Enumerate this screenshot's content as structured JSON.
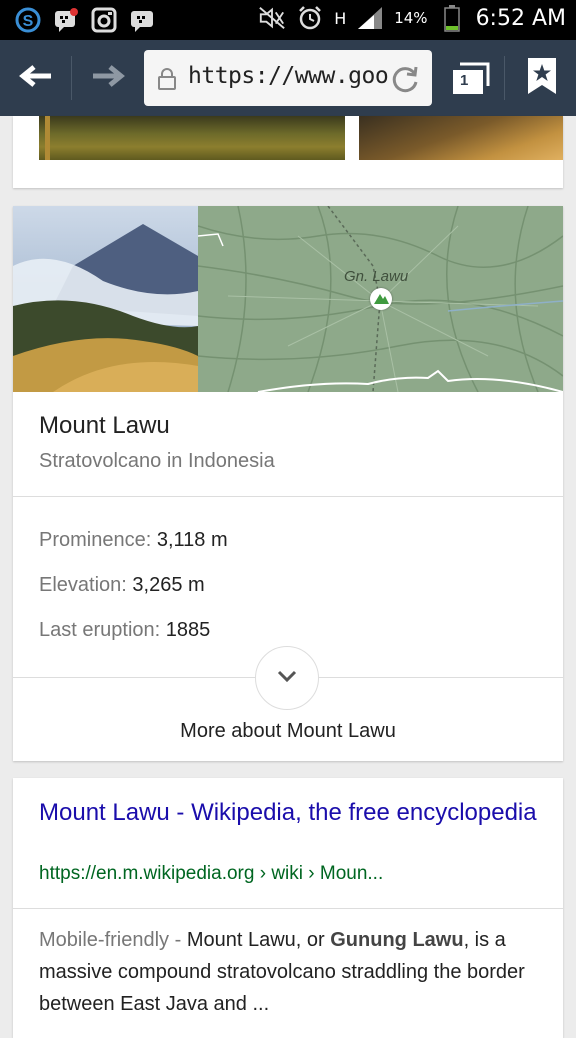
{
  "status_bar": {
    "battery_percent": "14%",
    "time": "6:52 AM",
    "network_type": "H",
    "icons": [
      "skype-icon",
      "bbm-icon",
      "instagram-icon",
      "bbm-icon",
      "mute-icon",
      "alarm-icon",
      "data-arrows-icon",
      "signal-icon",
      "battery-icon"
    ]
  },
  "toolbar": {
    "url": "https://www.goo",
    "tab_count": "1",
    "icons": [
      "back-arrow-icon",
      "forward-arrow-icon",
      "lock-icon",
      "reload-icon",
      "tabs-icon",
      "bookmark-star-icon"
    ]
  },
  "knowledge_panel": {
    "map_label": "Gn. Lawu",
    "title": "Mount Lawu",
    "subtitle": "Stratovolcano in Indonesia",
    "facts": [
      {
        "label": "Prominence:",
        "value": "3,118 m"
      },
      {
        "label": "Elevation:",
        "value": "3,265 m"
      },
      {
        "label": "Last eruption:",
        "value": "1885"
      }
    ],
    "more_label": "More about Mount Lawu"
  },
  "result": {
    "title": "Mount Lawu - Wikipedia, the free encyclopedia",
    "url": "https://en.m.wikipedia.org › wiki › Moun...",
    "mobile_friendly": "Mobile-friendly - ",
    "snippet_part1": "Mount Lawu, or ",
    "snippet_bold": "Gunung Lawu",
    "snippet_part2": ", is a massive compound stratovolcano straddling the border between East Java and ..."
  },
  "colors": {
    "toolbar_bg": "#2f3d4e",
    "link_blue": "#1a0dab",
    "url_green": "#006621",
    "map_green": "#8ea98a"
  }
}
